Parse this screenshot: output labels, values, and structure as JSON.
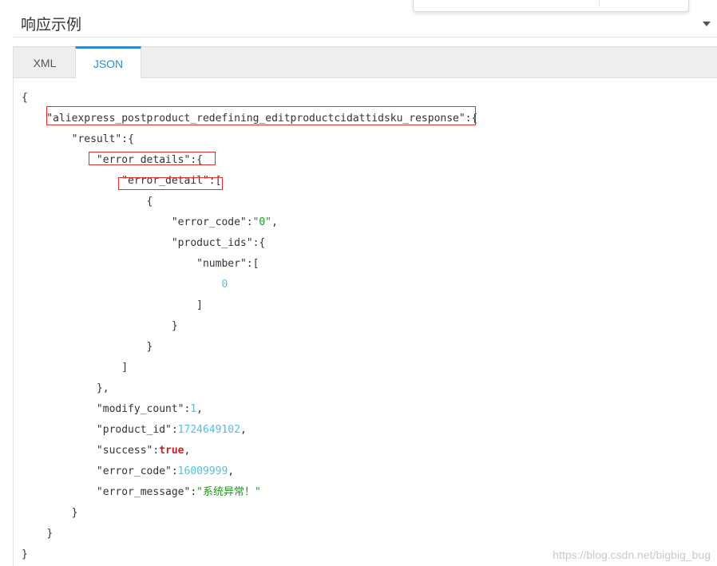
{
  "section": {
    "title": "响应示例",
    "collapse_icon": "chevron-down-icon"
  },
  "tabs": [
    {
      "label": "XML",
      "active": false
    },
    {
      "label": "JSON",
      "active": true
    }
  ],
  "json_view": {
    "lines": [
      {
        "indent": 0,
        "parts": [
          {
            "t": "k",
            "v": "{"
          }
        ]
      },
      {
        "indent": 1,
        "parts": [
          {
            "t": "k",
            "v": "\"aliexpress_postproduct_redefining_editproductcidattidsku_response\":{"
          }
        ]
      },
      {
        "indent": 2,
        "parts": [
          {
            "t": "k",
            "v": "\"result\":{"
          }
        ]
      },
      {
        "indent": 3,
        "parts": [
          {
            "t": "k",
            "v": "\"error_details\":{"
          }
        ]
      },
      {
        "indent": 4,
        "parts": [
          {
            "t": "k",
            "v": "\"error_detail\":["
          }
        ]
      },
      {
        "indent": 5,
        "parts": [
          {
            "t": "k",
            "v": "{"
          }
        ]
      },
      {
        "indent": 6,
        "parts": [
          {
            "t": "k",
            "v": "\"error_code\":"
          },
          {
            "t": "s",
            "v": "\"0\""
          },
          {
            "t": "k",
            "v": ","
          }
        ]
      },
      {
        "indent": 6,
        "parts": [
          {
            "t": "k",
            "v": "\"product_ids\":{"
          }
        ]
      },
      {
        "indent": 7,
        "parts": [
          {
            "t": "k",
            "v": "\"number\":["
          }
        ]
      },
      {
        "indent": 8,
        "parts": [
          {
            "t": "n",
            "v": "0"
          }
        ]
      },
      {
        "indent": 7,
        "parts": [
          {
            "t": "k",
            "v": "]"
          }
        ]
      },
      {
        "indent": 6,
        "parts": [
          {
            "t": "k",
            "v": "}"
          }
        ]
      },
      {
        "indent": 5,
        "parts": [
          {
            "t": "k",
            "v": "}"
          }
        ]
      },
      {
        "indent": 4,
        "parts": [
          {
            "t": "k",
            "v": "]"
          }
        ]
      },
      {
        "indent": 3,
        "parts": [
          {
            "t": "k",
            "v": "},"
          }
        ]
      },
      {
        "indent": 3,
        "parts": [
          {
            "t": "k",
            "v": "\"modify_count\":"
          },
          {
            "t": "n",
            "v": "1"
          },
          {
            "t": "k",
            "v": ","
          }
        ]
      },
      {
        "indent": 3,
        "parts": [
          {
            "t": "k",
            "v": "\"product_id\":"
          },
          {
            "t": "n",
            "v": "1724649102"
          },
          {
            "t": "k",
            "v": ","
          }
        ]
      },
      {
        "indent": 3,
        "parts": [
          {
            "t": "k",
            "v": "\"success\":"
          },
          {
            "t": "b",
            "v": "true"
          },
          {
            "t": "k",
            "v": ","
          }
        ]
      },
      {
        "indent": 3,
        "parts": [
          {
            "t": "k",
            "v": "\"error_code\":"
          },
          {
            "t": "n",
            "v": "16009999"
          },
          {
            "t": "k",
            "v": ","
          }
        ]
      },
      {
        "indent": 3,
        "parts": [
          {
            "t": "k",
            "v": "\"error_message\":"
          },
          {
            "t": "s",
            "v": "\"系统异常！\""
          }
        ]
      },
      {
        "indent": 2,
        "parts": [
          {
            "t": "k",
            "v": "}"
          }
        ]
      },
      {
        "indent": 1,
        "parts": [
          {
            "t": "k",
            "v": "}"
          }
        ]
      },
      {
        "indent": 0,
        "parts": [
          {
            "t": "k",
            "v": "}"
          }
        ]
      }
    ],
    "highlighted_lines": [
      1,
      3,
      4
    ],
    "colors": {
      "string": "#1a9b1a",
      "number": "#4fc0e8",
      "boolean": "#cc1f1f",
      "highlight_box": "#e03030"
    }
  },
  "watermark": "https://blog.csdn.net/bigbig_bug"
}
